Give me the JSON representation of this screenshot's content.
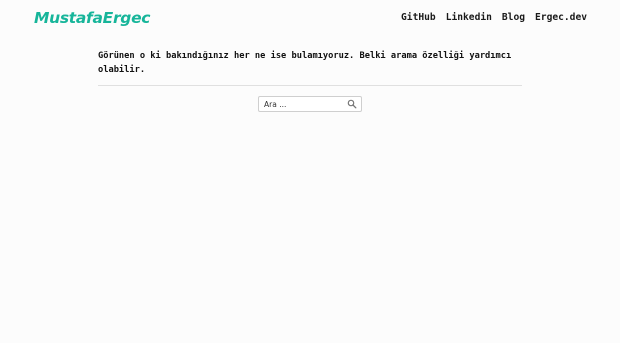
{
  "header": {
    "logo_text": "MustafaErgec",
    "nav": [
      {
        "label": "GitHub"
      },
      {
        "label": "Linkedin"
      },
      {
        "label": "Blog"
      },
      {
        "label": "Ergec.dev"
      }
    ]
  },
  "main": {
    "message": "Görünen o ki bakındığınız her ne ise bulamıyoruz. Belki arama özelliği yardımcı olabilir.",
    "search": {
      "placeholder": "Ara ...",
      "icon": "search-icon"
    }
  },
  "colors": {
    "brand": "#17b59a",
    "background": "#fcfcfc",
    "text": "#1a1a1a",
    "divider": "#e0e0e0"
  }
}
